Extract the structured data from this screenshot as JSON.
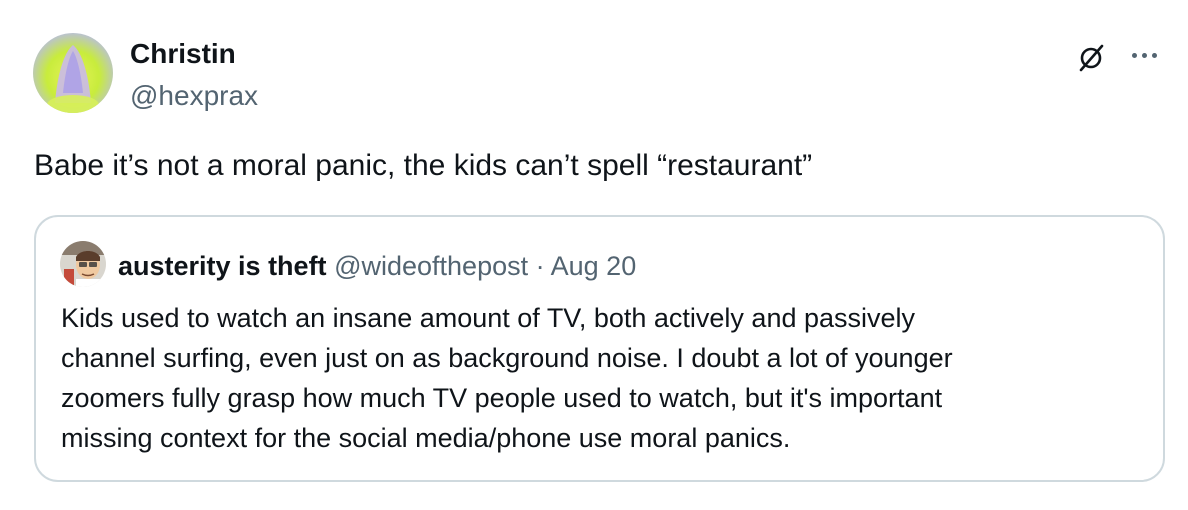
{
  "tweet": {
    "author": {
      "name": "Christin",
      "handle": "@hexprax",
      "avatar_icon": "avatar-praying-hands"
    },
    "text": "Babe it’s not a moral panic, the kids can’t spell “restaurant”",
    "actions": {
      "grok_icon": "grok-icon",
      "more_icon": "more-icon"
    },
    "quote": {
      "author": {
        "name": "austerity is theft",
        "handle": "@wideofthepost",
        "separator": "·",
        "date": "Aug 20",
        "avatar_icon": "avatar-cartoon"
      },
      "lines": [
        "Kids used to watch an insane amount of TV, both actively and passively",
        "channel surfing, even just on as background noise. I doubt a lot of younger",
        "zoomers fully grasp how much TV people used to watch, but it's important",
        "missing context for the social media/phone use moral panics."
      ]
    }
  },
  "colors": {
    "text_primary": "#0f1419",
    "text_secondary": "#536471",
    "border": "#cfd9de",
    "background": "#ffffff"
  }
}
